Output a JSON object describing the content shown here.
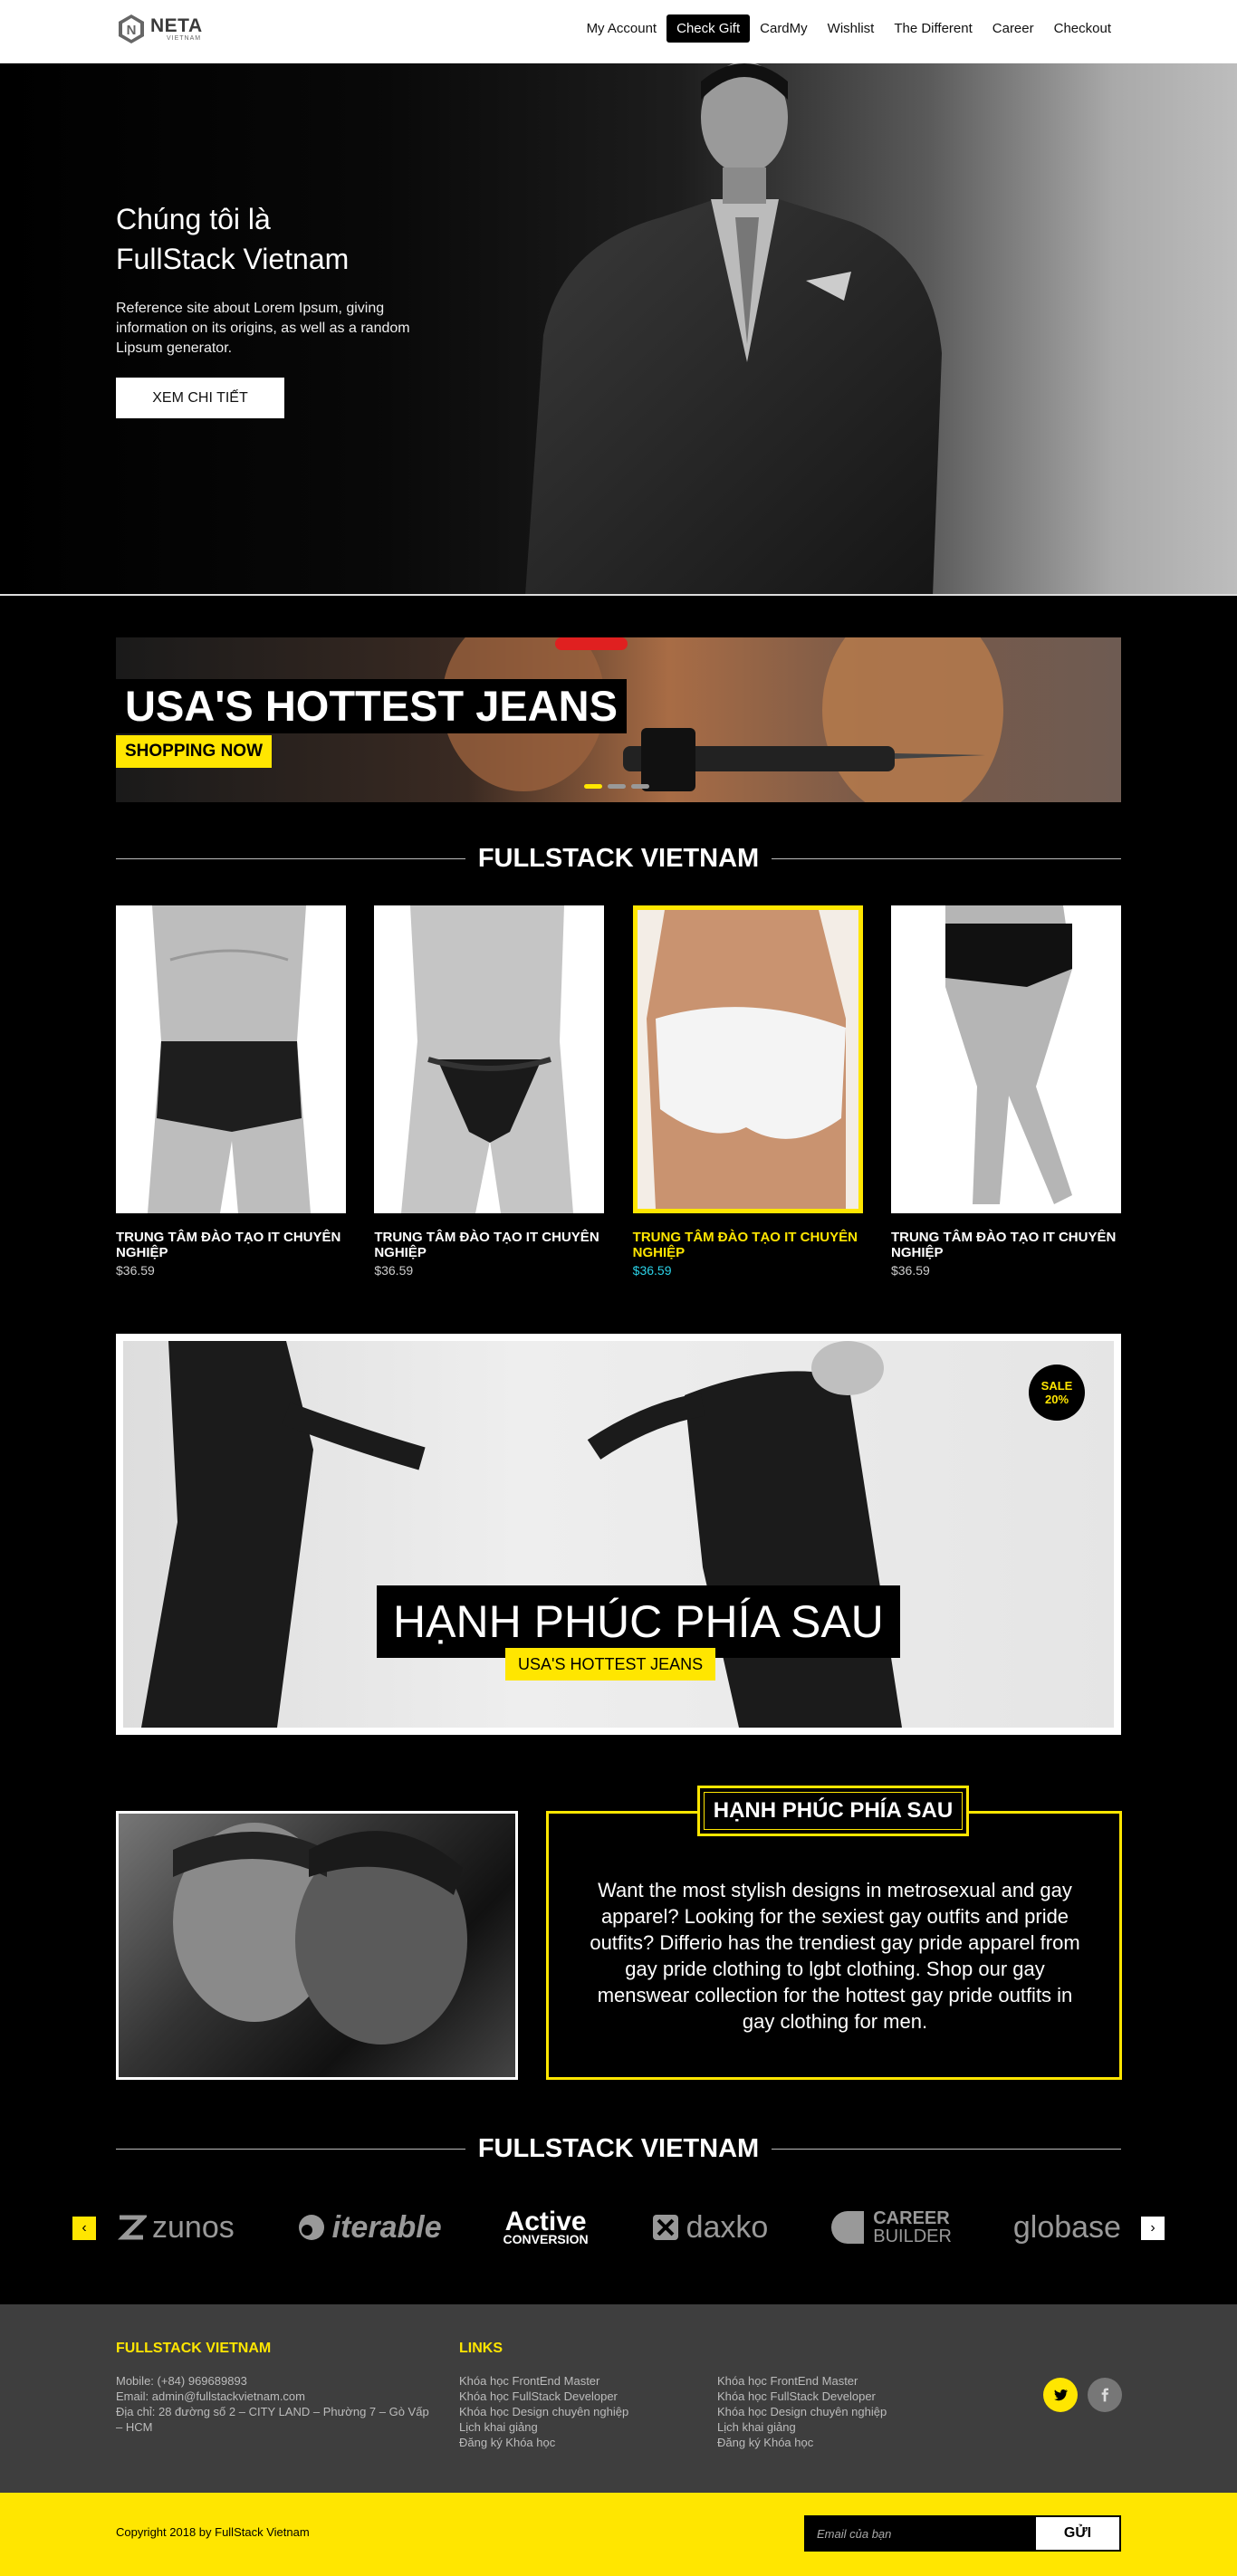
{
  "header": {
    "logo": {
      "name": "NETA",
      "sub": "VIETNAM"
    },
    "nav": [
      "My Account",
      "Check Gift",
      "CardMy",
      "Wishlist",
      "The Different",
      "Career",
      "Checkout"
    ],
    "active_nav": "Check Gift"
  },
  "hero": {
    "title_line1": "Chúng tôi là",
    "title_line2": "FullStack Vietnam",
    "description": "Reference site about Lorem Ipsum, giving information on its origins, as well as a random Lipsum generator.",
    "button": "XEM CHI TIẾT"
  },
  "banner": {
    "title": "USA'S HOTTEST JEANS",
    "button": "SHOPPING NOW",
    "slides": 3,
    "active_slide": 1
  },
  "section1": {
    "heading": "FULLSTACK VIETNAM"
  },
  "products": [
    {
      "name": "TRUNG TÂM ĐÀO TẠO IT CHUYÊN NGHIỆP",
      "price": "$36.59",
      "featured": false
    },
    {
      "name": "TRUNG TÂM ĐÀO TẠO IT CHUYÊN NGHIỆP",
      "price": "$36.59",
      "featured": false
    },
    {
      "name": "TRUNG TÂM ĐÀO TẠO IT CHUYÊN NGHIỆP",
      "price": "$36.59",
      "featured": true
    },
    {
      "name": "TRUNG TÂM ĐÀO TẠO IT CHUYÊN NGHIỆP",
      "price": "$36.59",
      "featured": false
    }
  ],
  "promo": {
    "badge_line1": "SALE",
    "badge_line2": "20%",
    "title": "HẠNH PHÚC PHÍA SAU",
    "subtitle": "USA'S HOTTEST JEANS"
  },
  "about": {
    "label": "HẠNH PHÚC PHÍA SAU",
    "text": "Want the most stylish designs in metrosexual and gay apparel? Looking for the sexiest gay outfits and pride outfits? Differio has the trendiest gay pride apparel from gay pride clothing to lgbt clothing. Shop our gay menswear collection for the hottest gay pride outfits in gay clothing for men."
  },
  "section2": {
    "heading": "FULLSTACK VIETNAM"
  },
  "brands": [
    "zunos",
    "iterable",
    "Active",
    "CONVERSION",
    "daxko",
    "CAREER",
    "BUILDER",
    "globase"
  ],
  "footer": {
    "col1_title": "FULLSTACK VIETNAM",
    "contact": [
      "Mobile: (+84) 969689893",
      "Email: admin@fullstackvietnam.com",
      "Địa chỉ: 28 đường số 2 – CITY LAND – Phường 7 – Gò Vấp – HCM"
    ],
    "col2_title": "LINKS",
    "links1": [
      "Khóa học FrontEnd Master",
      "Khóa học FullStack Developer",
      "Khóa học Design chuyên nghiệp",
      "Lịch khai giảng",
      "Đăng ký Khóa học"
    ],
    "links2": [
      "Khóa học FrontEnd Master",
      "Khóa học FullStack Developer",
      "Khóa học Design chuyên nghiệp",
      "Lịch khai giảng",
      "Đăng ký Khóa học"
    ],
    "copyright": "Copyright 2018 by FullStack Vietnam",
    "subscribe_placeholder": "Email của bạn",
    "subscribe_button": "GỬI"
  },
  "colors": {
    "accent": "#ffe600",
    "price_featured": "#2bd1e6",
    "footer_bg": "#3e3e3e"
  },
  "icons": [
    "logo-hex-icon",
    "chevron-left-icon",
    "chevron-right-icon",
    "twitter-icon",
    "facebook-icon"
  ]
}
